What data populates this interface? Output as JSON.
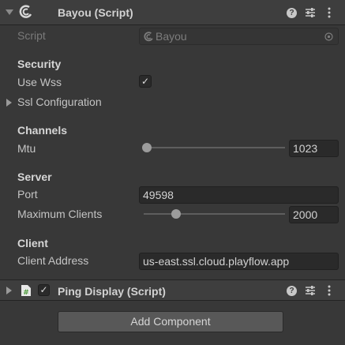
{
  "components": {
    "bayou": {
      "title": "Bayou (Script)",
      "script_label": "Script",
      "script_value": "Bayou",
      "icons": [
        "help-icon",
        "presets-icon",
        "kebab-menu-icon"
      ]
    },
    "ping": {
      "title": "Ping Display (Script)",
      "enabled": true
    }
  },
  "security": {
    "heading": "Security",
    "use_wss_label": "Use Wss",
    "use_wss": true,
    "ssl_label": "Ssl Configuration"
  },
  "channels": {
    "heading": "Channels",
    "mtu_label": "Mtu",
    "mtu_value": "1023",
    "mtu_slider_fraction": 0
  },
  "server": {
    "heading": "Server",
    "port_label": "Port",
    "port_value": "49598",
    "max_clients_label": "Maximum Clients",
    "max_clients_value": "2000",
    "max_clients_slider_fraction": 0.22
  },
  "client": {
    "heading": "Client",
    "address_label": "Client Address",
    "address_value": "us-east.ssl.cloud.playflow.app"
  },
  "footer": {
    "add_component_label": "Add Component"
  },
  "colors": {
    "background": "#383838",
    "header": "#3e3e3e",
    "field": "#2a2a2a",
    "button": "#585858"
  }
}
